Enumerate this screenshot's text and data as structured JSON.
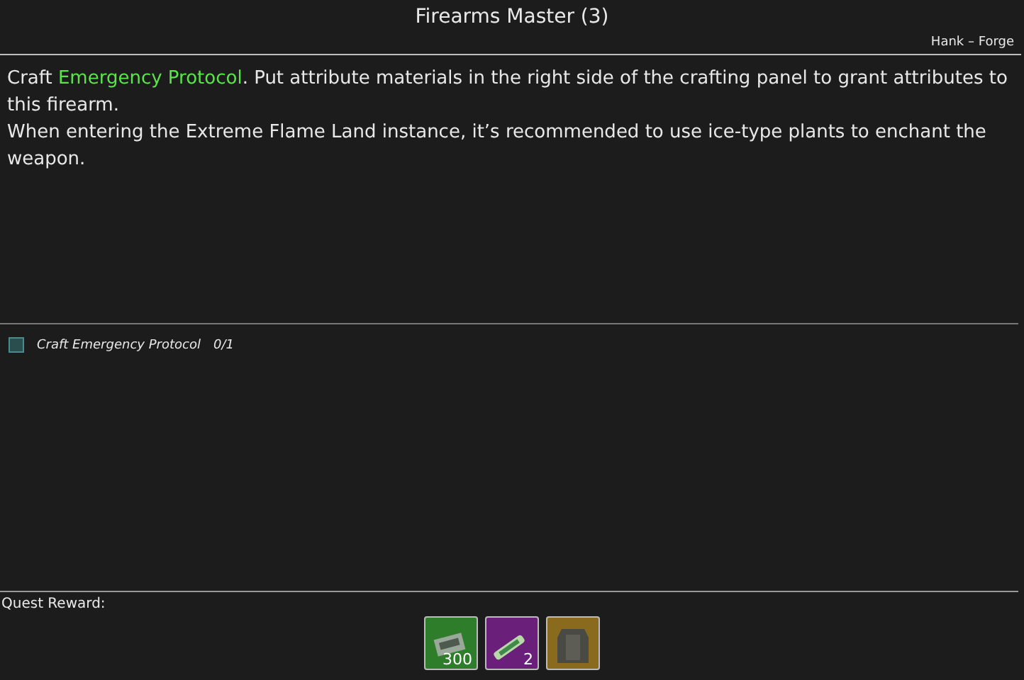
{
  "title": "Firearms Master (3)",
  "giver": "Hank – Forge",
  "description": [
    [
      {
        "text": "Craft ",
        "kind": "plain"
      },
      {
        "text": "Emergency Protocol",
        "kind": "highlight"
      },
      {
        "text": ". Put attribute materials in the right side of the crafting panel to grant attributes to this firearm.",
        "kind": "plain"
      }
    ],
    [
      {
        "text": "When entering the Extreme Flame Land instance, it’s recommended to use ice-type plants to enchant the weapon.",
        "kind": "plain"
      }
    ]
  ],
  "objectives": [
    {
      "label": "Craft Emergency Protocol",
      "progress": "0/1",
      "checked": false
    }
  ],
  "reward_label": "Quest Reward:",
  "rewards": [
    {
      "kind": "ammo",
      "color": "#2e7d2a",
      "count": "300"
    },
    {
      "kind": "crystal",
      "color": "#6a1f7a",
      "count": "2"
    },
    {
      "kind": "armor",
      "color": "#8a6a1c"
    }
  ]
}
